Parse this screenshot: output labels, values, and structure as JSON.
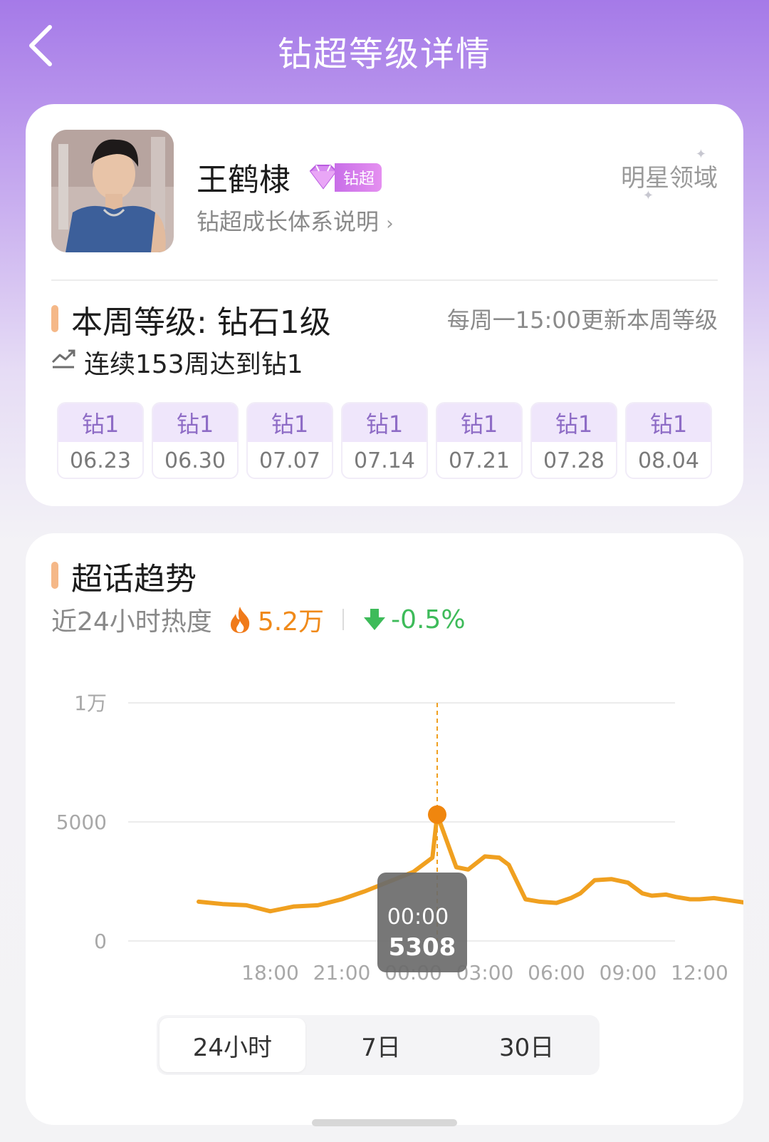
{
  "header": {
    "title": "钻超等级详情"
  },
  "profile": {
    "name": "王鹤棣",
    "badge_label": "钻超",
    "growth_link": "钻超成长体系说明",
    "domain": "明星领域"
  },
  "level": {
    "title": "本周等级: 钻石1级",
    "update_note": "每周一15:00更新本周等级",
    "streak": "连续153周达到钻1",
    "weeks": [
      {
        "level": "钻1",
        "date": "06.23"
      },
      {
        "level": "钻1",
        "date": "06.30"
      },
      {
        "level": "钻1",
        "date": "07.07"
      },
      {
        "level": "钻1",
        "date": "07.14"
      },
      {
        "level": "钻1",
        "date": "07.21"
      },
      {
        "level": "钻1",
        "date": "07.28"
      },
      {
        "level": "钻1",
        "date": "08.04"
      }
    ]
  },
  "trend": {
    "title": "超话趋势",
    "heat_label": "近24小时热度",
    "heat_value": "5.2万",
    "heat_change": "-0.5%",
    "tabs": [
      "24小时",
      "7日",
      "30日"
    ],
    "active_tab": 0
  },
  "colors": {
    "line": "#f0a020",
    "highlight": "#f08a1a",
    "down": "#3ebb5a",
    "accent": "#f5b888",
    "week_level_bg": "#efe6fb"
  },
  "chart_data": {
    "type": "line",
    "x_tick_labels": [
      "18:00",
      "21:00",
      "00:00",
      "03:00",
      "06:00",
      "09:00",
      "12:00"
    ],
    "x": [
      -3,
      -2,
      -1,
      0,
      1,
      2,
      3,
      4,
      5,
      6,
      6.8,
      7,
      7.8,
      8.3,
      9,
      9.6,
      10,
      10.7,
      11.3,
      12,
      12.6,
      13,
      13.6,
      14.3,
      15,
      15.6,
      16,
      16.6,
      17,
      17.6,
      18,
      18.6,
      19.3,
      20,
      20.7
    ],
    "values": [
      1650,
      1550,
      1500,
      1250,
      1450,
      1500,
      1750,
      2100,
      2500,
      2900,
      3500,
      5308,
      3100,
      3000,
      3550,
      3500,
      3200,
      1750,
      1650,
      1600,
      1800,
      2000,
      2550,
      2600,
      2450,
      2000,
      1900,
      1950,
      1850,
      1750,
      1750,
      1800,
      1700,
      1600,
      1500
    ],
    "y_tick_labels": [
      "0",
      "5000",
      "1万"
    ],
    "y_ticks": [
      0,
      5000,
      10000
    ],
    "ylim": [
      0,
      10000
    ],
    "tooltip": {
      "time": "00:00",
      "value": "5308"
    }
  }
}
